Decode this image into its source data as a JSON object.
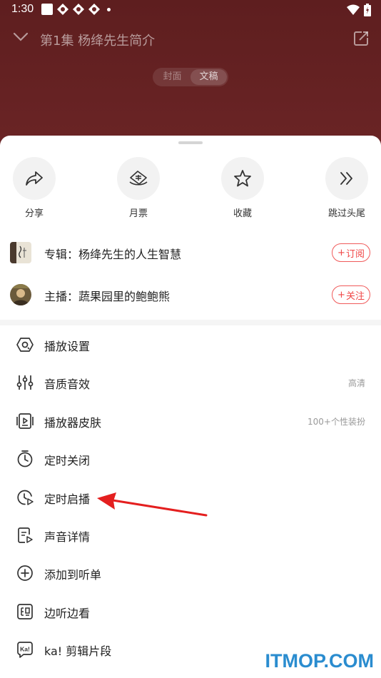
{
  "status": {
    "time": "1:30"
  },
  "player": {
    "title": "第1集 杨绛先生简介",
    "tabs": [
      {
        "label": "封面",
        "active": false
      },
      {
        "label": "文稿",
        "active": true
      }
    ]
  },
  "actions": [
    {
      "label": "分享",
      "icon": "share-icon"
    },
    {
      "label": "月票",
      "icon": "ticket-icon"
    },
    {
      "label": "收藏",
      "icon": "star-icon"
    },
    {
      "label": "跳过头尾",
      "icon": "skip-icon"
    }
  ],
  "album": {
    "label": "专辑：杨绛先生的人生智慧",
    "button": "订阅"
  },
  "host": {
    "label": "主播：蔬果园里的鲍鲍熊",
    "button": "关注"
  },
  "menu": [
    {
      "label": "播放设置",
      "value": "",
      "icon": "play-settings-icon"
    },
    {
      "label": "音质音效",
      "value": "高清",
      "icon": "equalizer-icon"
    },
    {
      "label": "播放器皮肤",
      "value": "100+个性装扮",
      "icon": "skin-icon"
    },
    {
      "label": "定时关闭",
      "value": "",
      "icon": "timer-icon"
    },
    {
      "label": "定时启播",
      "value": "",
      "icon": "timer-play-icon"
    },
    {
      "label": "声音详情",
      "value": "",
      "icon": "details-icon"
    },
    {
      "label": "添加到听单",
      "value": "",
      "icon": "add-circle-icon"
    },
    {
      "label": "边听边看",
      "value": "",
      "icon": "listen-watch-icon"
    },
    {
      "label": "ka! 剪辑片段",
      "value": "",
      "icon": "ka-clip-icon"
    }
  ],
  "watermark": "ITMOP.COM",
  "colors": {
    "accent": "#f04646",
    "player_bg": "#6b2324",
    "watermark": "#2a8ccf"
  }
}
